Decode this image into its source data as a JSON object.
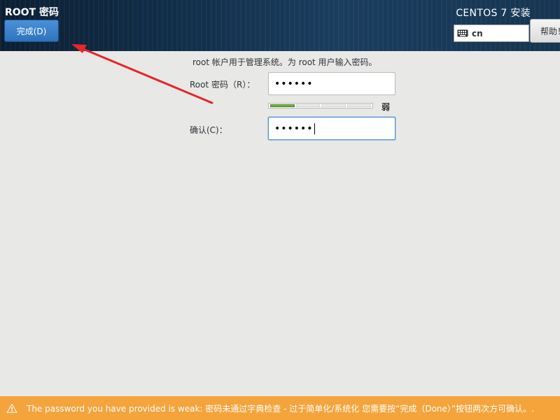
{
  "header": {
    "spoke_title": "ROOT 密码",
    "done_button": "完成(D)",
    "product_title": "CENTOS 7 安装",
    "keyboard_layout": "cn",
    "help_button": "帮助！"
  },
  "form": {
    "instructions": "root 帐户用于管理系统。为 root 用户输入密码。",
    "password_label": "Root 密码（R）：",
    "password_value": "••••••",
    "confirm_label": "确认(C)：",
    "confirm_value": "••••••",
    "strength_label": "弱",
    "strength_level": 0.25
  },
  "warning": {
    "text": "The password you have provided is weak: 密码未通过字典检查 - 过于简单化/系统化 您需要按“完成（Done）”按钮两次方可确认。."
  },
  "annotation": {
    "arrow_color": "#e8262b"
  },
  "colors": {
    "accent": "#2f73bd",
    "warning": "#f5a43c",
    "strength": "#5e9b2c"
  }
}
